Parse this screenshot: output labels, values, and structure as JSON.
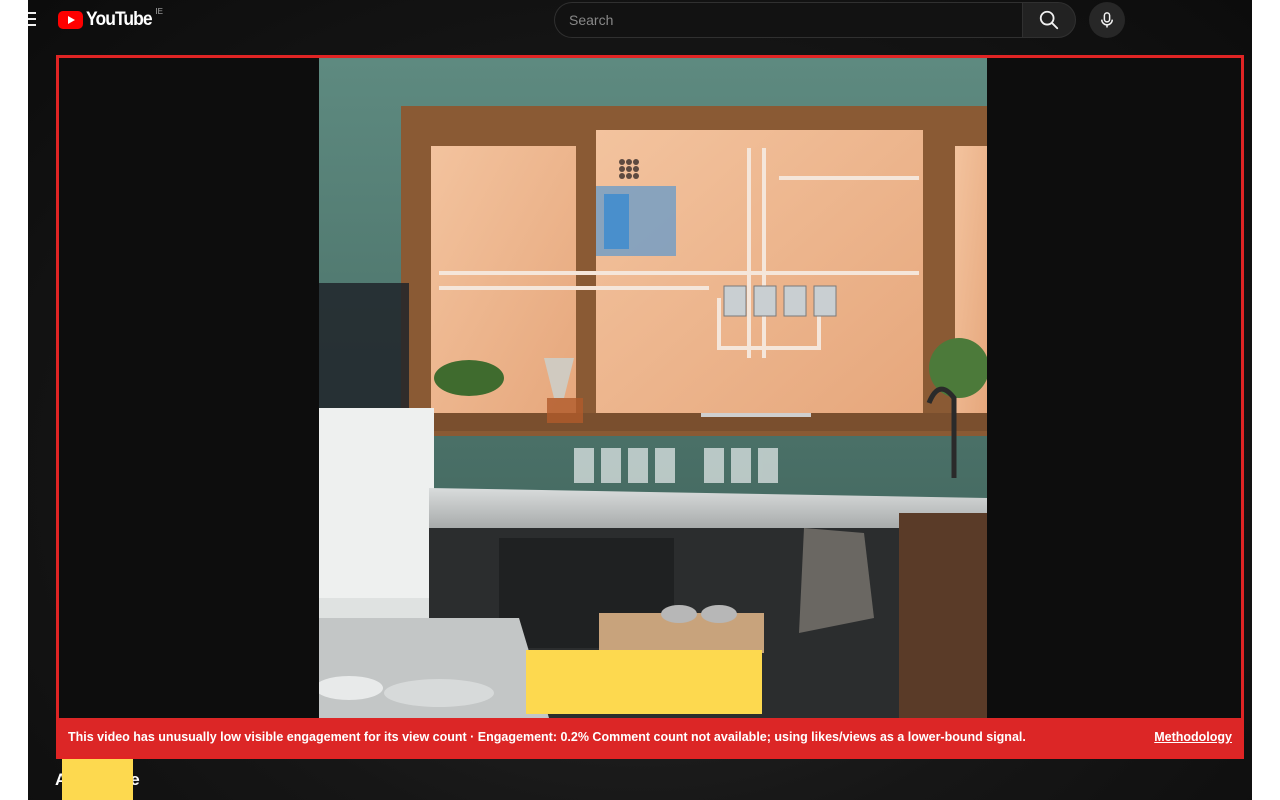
{
  "masthead": {
    "logo_text": "YouTube",
    "region": "IE",
    "search_placeholder": "Search",
    "icons": [
      "menu-icon",
      "search-icon",
      "microphone-icon"
    ]
  },
  "player": {
    "warning": "This video has unusually low visible engagement for its view count · Engagement: 0.2% Comment count not available; using likes/views as a lower-bound signal.",
    "methodology_label": "Methodology",
    "border_color": "#e02424",
    "banner_color": "#dc2626"
  },
  "title": {
    "visible_start": "A",
    "visible_end": "e"
  },
  "colors": {
    "redaction": "#fdd94f",
    "brand_red": "#ff0000"
  }
}
